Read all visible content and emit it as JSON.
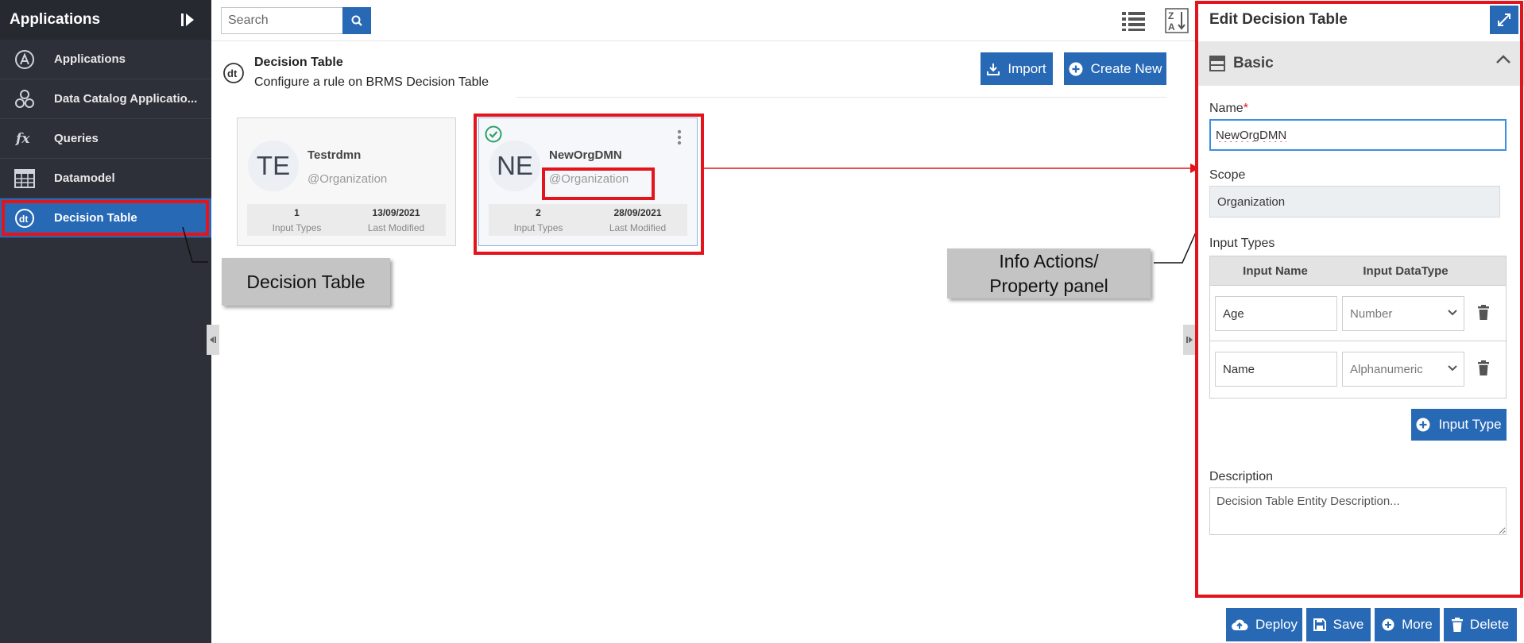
{
  "sidebar": {
    "title": "Applications",
    "items": [
      {
        "label": "Applications",
        "icon": "applications-icon"
      },
      {
        "label": "Data Catalog Applicatio...",
        "icon": "data-catalog-icon"
      },
      {
        "label": "Queries",
        "icon": "fx-icon"
      },
      {
        "label": "Datamodel",
        "icon": "table-grid-icon"
      },
      {
        "label": "Decision Table",
        "icon": "decision-table-icon",
        "active": true
      }
    ]
  },
  "topbar": {
    "search_placeholder": "Search"
  },
  "main": {
    "title": "Decision Table",
    "subtitle": "Configure a rule on BRMS Decision Table",
    "import_label": "Import",
    "create_label": "Create New",
    "cards": [
      {
        "initials": "TE",
        "name": "Testrdmn",
        "scope": "@Organization",
        "input_types": "1",
        "input_types_label": "Input Types",
        "last_modified": "13/09/2021",
        "last_modified_label": "Last Modified",
        "selected": false
      },
      {
        "initials": "NE",
        "name": "NewOrgDMN",
        "scope": "@Organization",
        "input_types": "2",
        "input_types_label": "Input Types",
        "last_modified": "28/09/2021",
        "last_modified_label": "Last Modified",
        "selected": true
      }
    ]
  },
  "callouts": {
    "decision_table": "Decision Table",
    "info_line1": "Info Actions/",
    "info_line2": "Property panel"
  },
  "panel": {
    "title": "Edit Decision Table",
    "section": "Basic",
    "name_label": "Name",
    "required_mark": "*",
    "name_value": "NewOrgDMN",
    "scope_label": "Scope",
    "scope_value": "Organization",
    "input_types_label": "Input Types",
    "col_input_name": "Input Name",
    "col_input_datatype": "Input DataType",
    "rows": [
      {
        "name": "Age",
        "datatype": "Number"
      },
      {
        "name": "Name",
        "datatype": "Alphanumeric"
      }
    ],
    "add_input_label": "Input Type",
    "description_label": "Description",
    "description_placeholder": "Decision Table Entity Description..."
  },
  "actions": {
    "deploy": "Deploy",
    "save": "Save",
    "more": "More",
    "delete": "Delete"
  },
  "colors": {
    "accent": "#2869b6",
    "sidebar_bg": "#2d3038",
    "highlight": "#e3141b"
  }
}
